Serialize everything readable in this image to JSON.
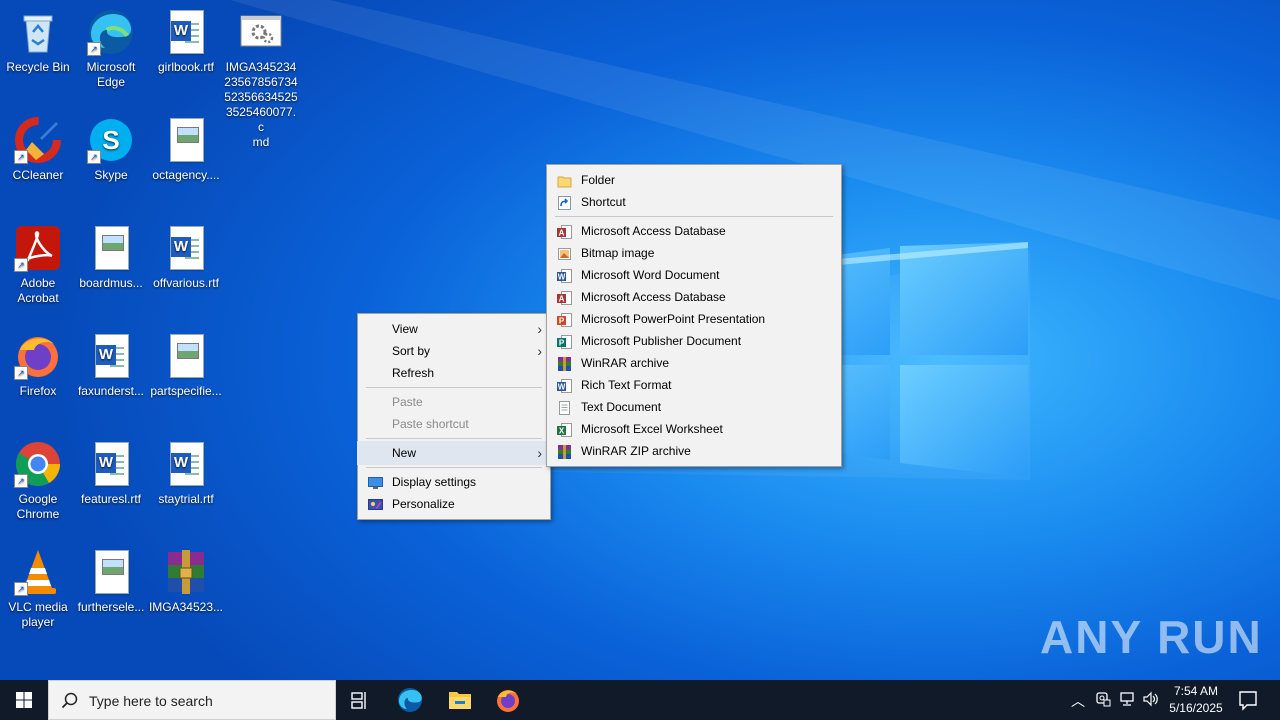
{
  "desktop": {
    "icons": [
      {
        "label": "Recycle Bin"
      },
      {
        "label": "Microsoft Edge"
      },
      {
        "label": "girlbook.rtf"
      },
      {
        "label": "IMGA34523423567856734523566345253525460077.cmd",
        "display": "IMGA345234\n23567856734\n52356634525\n3525460077.c\nmd"
      },
      {
        "label": "CCleaner"
      },
      {
        "label": "Skype"
      },
      {
        "label": "octagency...."
      },
      {
        "label": "Adobe Acrobat"
      },
      {
        "label": "boardmus..."
      },
      {
        "label": "offvarious.rtf"
      },
      {
        "label": "Firefox"
      },
      {
        "label": "faxunderst..."
      },
      {
        "label": "partspecifie..."
      },
      {
        "label": "Google Chrome"
      },
      {
        "label": "featuresl.rtf"
      },
      {
        "label": "staytrial.rtf"
      },
      {
        "label": "VLC media player"
      },
      {
        "label": "furtherselе...",
        "display": "furthersele..."
      },
      {
        "label": "IMGA34523..."
      }
    ]
  },
  "context_menu": {
    "view": "View",
    "sort_by": "Sort by",
    "refresh": "Refresh",
    "paste": "Paste",
    "paste_shortcut": "Paste shortcut",
    "new": "New",
    "display_settings": "Display settings",
    "personalize": "Personalize"
  },
  "new_submenu": {
    "folder": "Folder",
    "shortcut": "Shortcut",
    "items": [
      {
        "label": "Microsoft Access Database",
        "icon": "access-icon"
      },
      {
        "label": "Bitmap image",
        "icon": "bitmap-icon"
      },
      {
        "label": "Microsoft Word Document",
        "icon": "word-icon"
      },
      {
        "label": "Microsoft Access Database",
        "icon": "access-icon"
      },
      {
        "label": "Microsoft PowerPoint Presentation",
        "icon": "powerpoint-icon"
      },
      {
        "label": "Microsoft Publisher Document",
        "icon": "publisher-icon"
      },
      {
        "label": "WinRAR archive",
        "icon": "winrar-icon"
      },
      {
        "label": "Rich Text Format",
        "icon": "word-icon"
      },
      {
        "label": "Text Document",
        "icon": "text-icon"
      },
      {
        "label": "Microsoft Excel Worksheet",
        "icon": "excel-icon"
      },
      {
        "label": "WinRAR ZIP archive",
        "icon": "winrar-icon"
      }
    ]
  },
  "taskbar": {
    "search_placeholder": "Type here to search",
    "time": "7:54 AM",
    "date": "5/16/2025"
  },
  "watermark": "ANY RUN",
  "colors": {
    "desktop_blue": "#0a62d8",
    "menu_bg": "#f2f2f2",
    "menu_highlight": "#dfe6f0",
    "taskbar_bg": "#101a29"
  }
}
